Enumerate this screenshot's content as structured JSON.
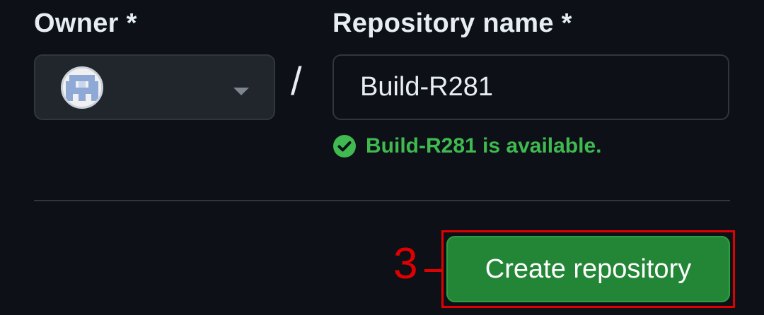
{
  "owner": {
    "label": "Owner *",
    "avatar_icon": "pixel-avatar-icon",
    "dropdown_icon": "caret-down-icon"
  },
  "separator": "/",
  "repository": {
    "label": "Repository name *",
    "value": "Build-R281",
    "availability_icon": "check-circle-icon",
    "availability_text": "Build-R281 is available."
  },
  "actions": {
    "create_label": "Create repository"
  },
  "annotation": {
    "step_number": "3",
    "color": "#e00000"
  },
  "colors": {
    "background": "#0d1117",
    "text": "#e6edf3",
    "success": "#3fb950",
    "button": "#238636",
    "border": "#30363d"
  }
}
